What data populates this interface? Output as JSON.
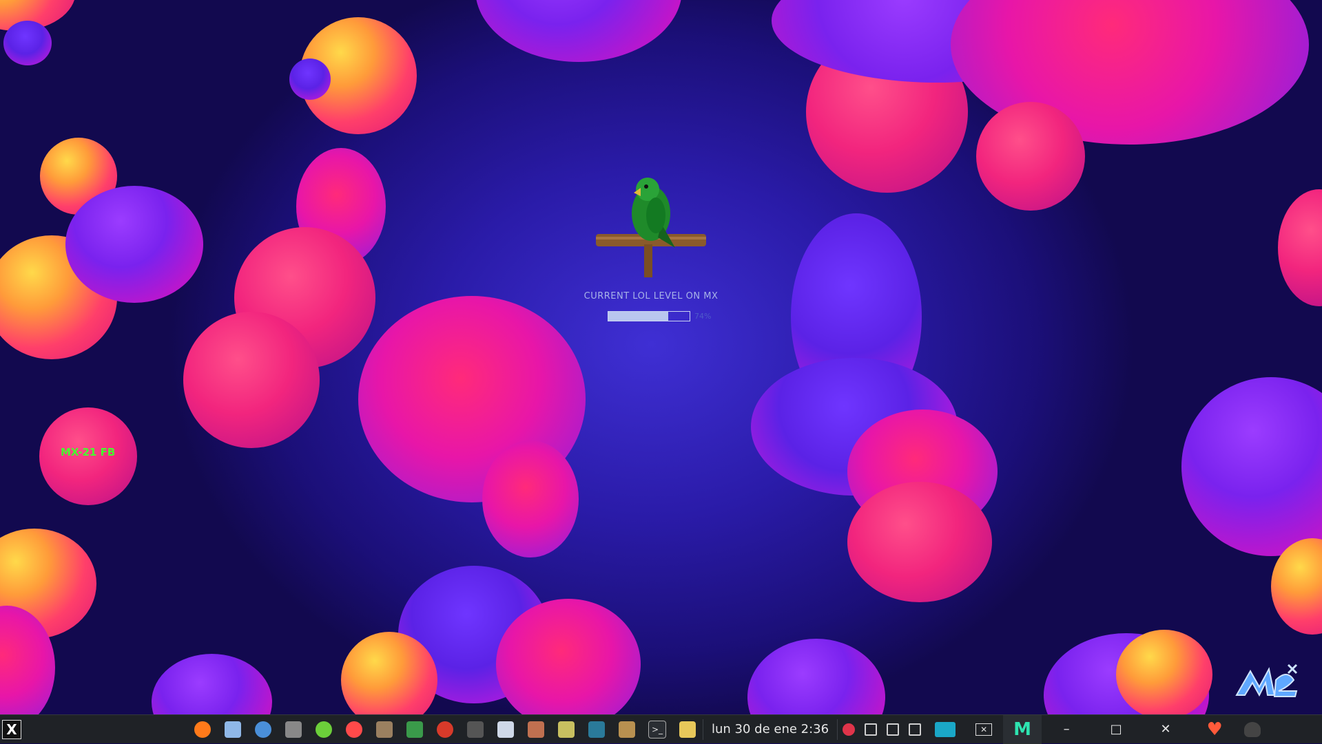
{
  "desktop": {
    "icon_label": "MX-21 FB",
    "logo_alt": "MX logo",
    "wallpaper": "purple-blob-wallpaper"
  },
  "widget": {
    "title": "CURRENT LOL LEVEL ON MX",
    "level_fraction": 0.74,
    "level_text": "74%"
  },
  "taskbar": {
    "start_icon": "x-logo-icon",
    "launchers": [
      {
        "name": "firefox-icon"
      },
      {
        "name": "window-list-icon"
      },
      {
        "name": "globe-icon"
      },
      {
        "name": "mouse-icon"
      },
      {
        "name": "green-blob-icon"
      },
      {
        "name": "color-wheel-icon"
      },
      {
        "name": "file-manager-icon"
      },
      {
        "name": "calculator-icon"
      },
      {
        "name": "red-circle-icon"
      },
      {
        "name": "camera-icon"
      },
      {
        "name": "text-editor-icon"
      },
      {
        "name": "paint-bucket-icon"
      },
      {
        "name": "alien-icon"
      },
      {
        "name": "screenshot-icon"
      },
      {
        "name": "jar-icon"
      },
      {
        "name": "terminal-icon"
      },
      {
        "name": "notes-icon"
      }
    ],
    "clock": "lun 30 de ene   2:36",
    "tray": [
      {
        "name": "cherry-icon"
      },
      {
        "name": "display-icon"
      },
      {
        "name": "clip-icon"
      },
      {
        "name": "volume-icon"
      }
    ],
    "colors": {
      "bar": "#1f2226",
      "accent": "#2ee3b0",
      "heart": "#ff5a3a"
    }
  }
}
